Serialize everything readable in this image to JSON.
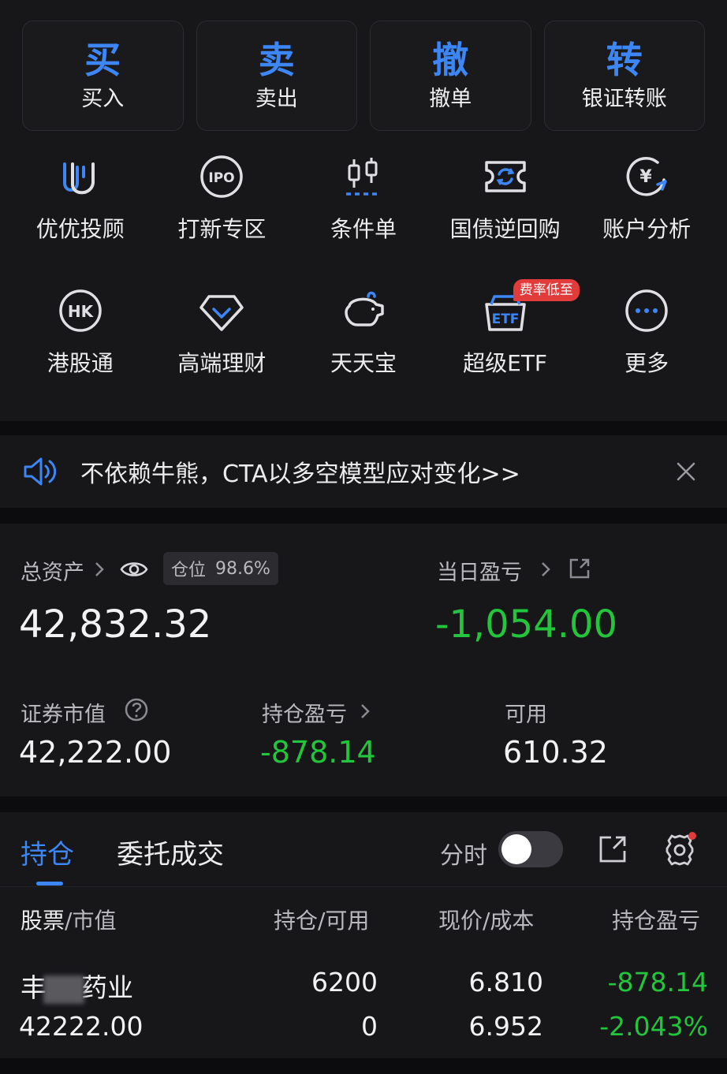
{
  "trade_buttons": [
    {
      "big": "买",
      "small": "买入"
    },
    {
      "big": "卖",
      "small": "卖出"
    },
    {
      "big": "撤",
      "small": "撤单"
    },
    {
      "big": "转",
      "small": "银证转账"
    }
  ],
  "grid_row1": [
    {
      "label": "优优投顾",
      "icon": "uu-advisor-icon"
    },
    {
      "label": "打新专区",
      "icon": "ipo-icon",
      "icon_text": "IPO"
    },
    {
      "label": "条件单",
      "icon": "condition-order-icon"
    },
    {
      "label": "国债逆回购",
      "icon": "bond-repo-icon"
    },
    {
      "label": "账户分析",
      "icon": "account-analysis-icon",
      "icon_text": "¥"
    }
  ],
  "grid_row2": [
    {
      "label": "港股通",
      "icon": "hk-connect-icon",
      "icon_text": "HK"
    },
    {
      "label": "高端理财",
      "icon": "diamond-icon"
    },
    {
      "label": "天天宝",
      "icon": "piggy-bank-icon"
    },
    {
      "label": "超级ETF",
      "icon": "etf-icon",
      "icon_text": "ETF",
      "badge": "费率低至"
    },
    {
      "label": "更多",
      "icon": "more-icon"
    }
  ],
  "notice": {
    "text": "不依赖牛熊，CTA以多空模型应对变化>>"
  },
  "assets": {
    "total_label": "总资产",
    "total_value": "42,832.32",
    "position_label": "仓位",
    "position_value": "98.6%",
    "daily_pl_label": "当日盈亏",
    "daily_pl_value": "-1,054.00",
    "market_value_label": "证券市值",
    "market_value": "42,222.00",
    "holding_pl_label": "持仓盈亏",
    "holding_pl_value": "-878.14",
    "available_label": "可用",
    "available_value": "610.32"
  },
  "holdings": {
    "tab_active": "持仓",
    "tab_other": "委托成交",
    "toggle_label": "分时",
    "headers": {
      "stock": "股票",
      "stock_sub": "/市值",
      "qty": "持仓/可用",
      "price": "现价/成本",
      "pl": "持仓盈亏"
    },
    "rows": [
      {
        "name_start": "丰",
        "name_end": "药业",
        "market_value": "42222.00",
        "qty": "6200",
        "available": "0",
        "price": "6.810",
        "cost": "6.952",
        "pl": "-878.14",
        "pl_pct": "-2.043%"
      }
    ]
  },
  "colors": {
    "accent": "#3d86f5",
    "loss": "#22c53b",
    "badge": "#e23b3b"
  }
}
